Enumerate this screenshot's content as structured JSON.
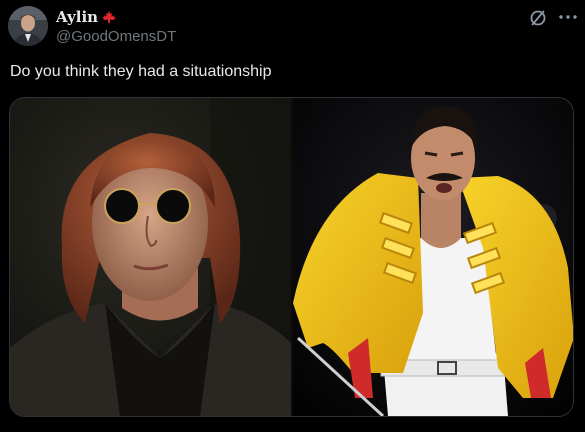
{
  "author": {
    "display_name": "Aylin",
    "handle": "@GoodOmensDT",
    "avatar": "profile-photo",
    "name_badge_icon": "maple-leaf-icon"
  },
  "actions": {
    "grok_icon": "grok-icon",
    "more_icon": "more-horizontal-icon"
  },
  "tweet": {
    "text": "Do you think they had a situationship"
  },
  "media": {
    "images": [
      {
        "description_icon": "photo-left"
      },
      {
        "description_icon": "photo-right"
      }
    ]
  },
  "colors": {
    "background": "#000000",
    "text_primary": "#e7e9ea",
    "text_secondary": "#71767b",
    "border": "#2f3336",
    "flag_red": "#e0252f"
  }
}
